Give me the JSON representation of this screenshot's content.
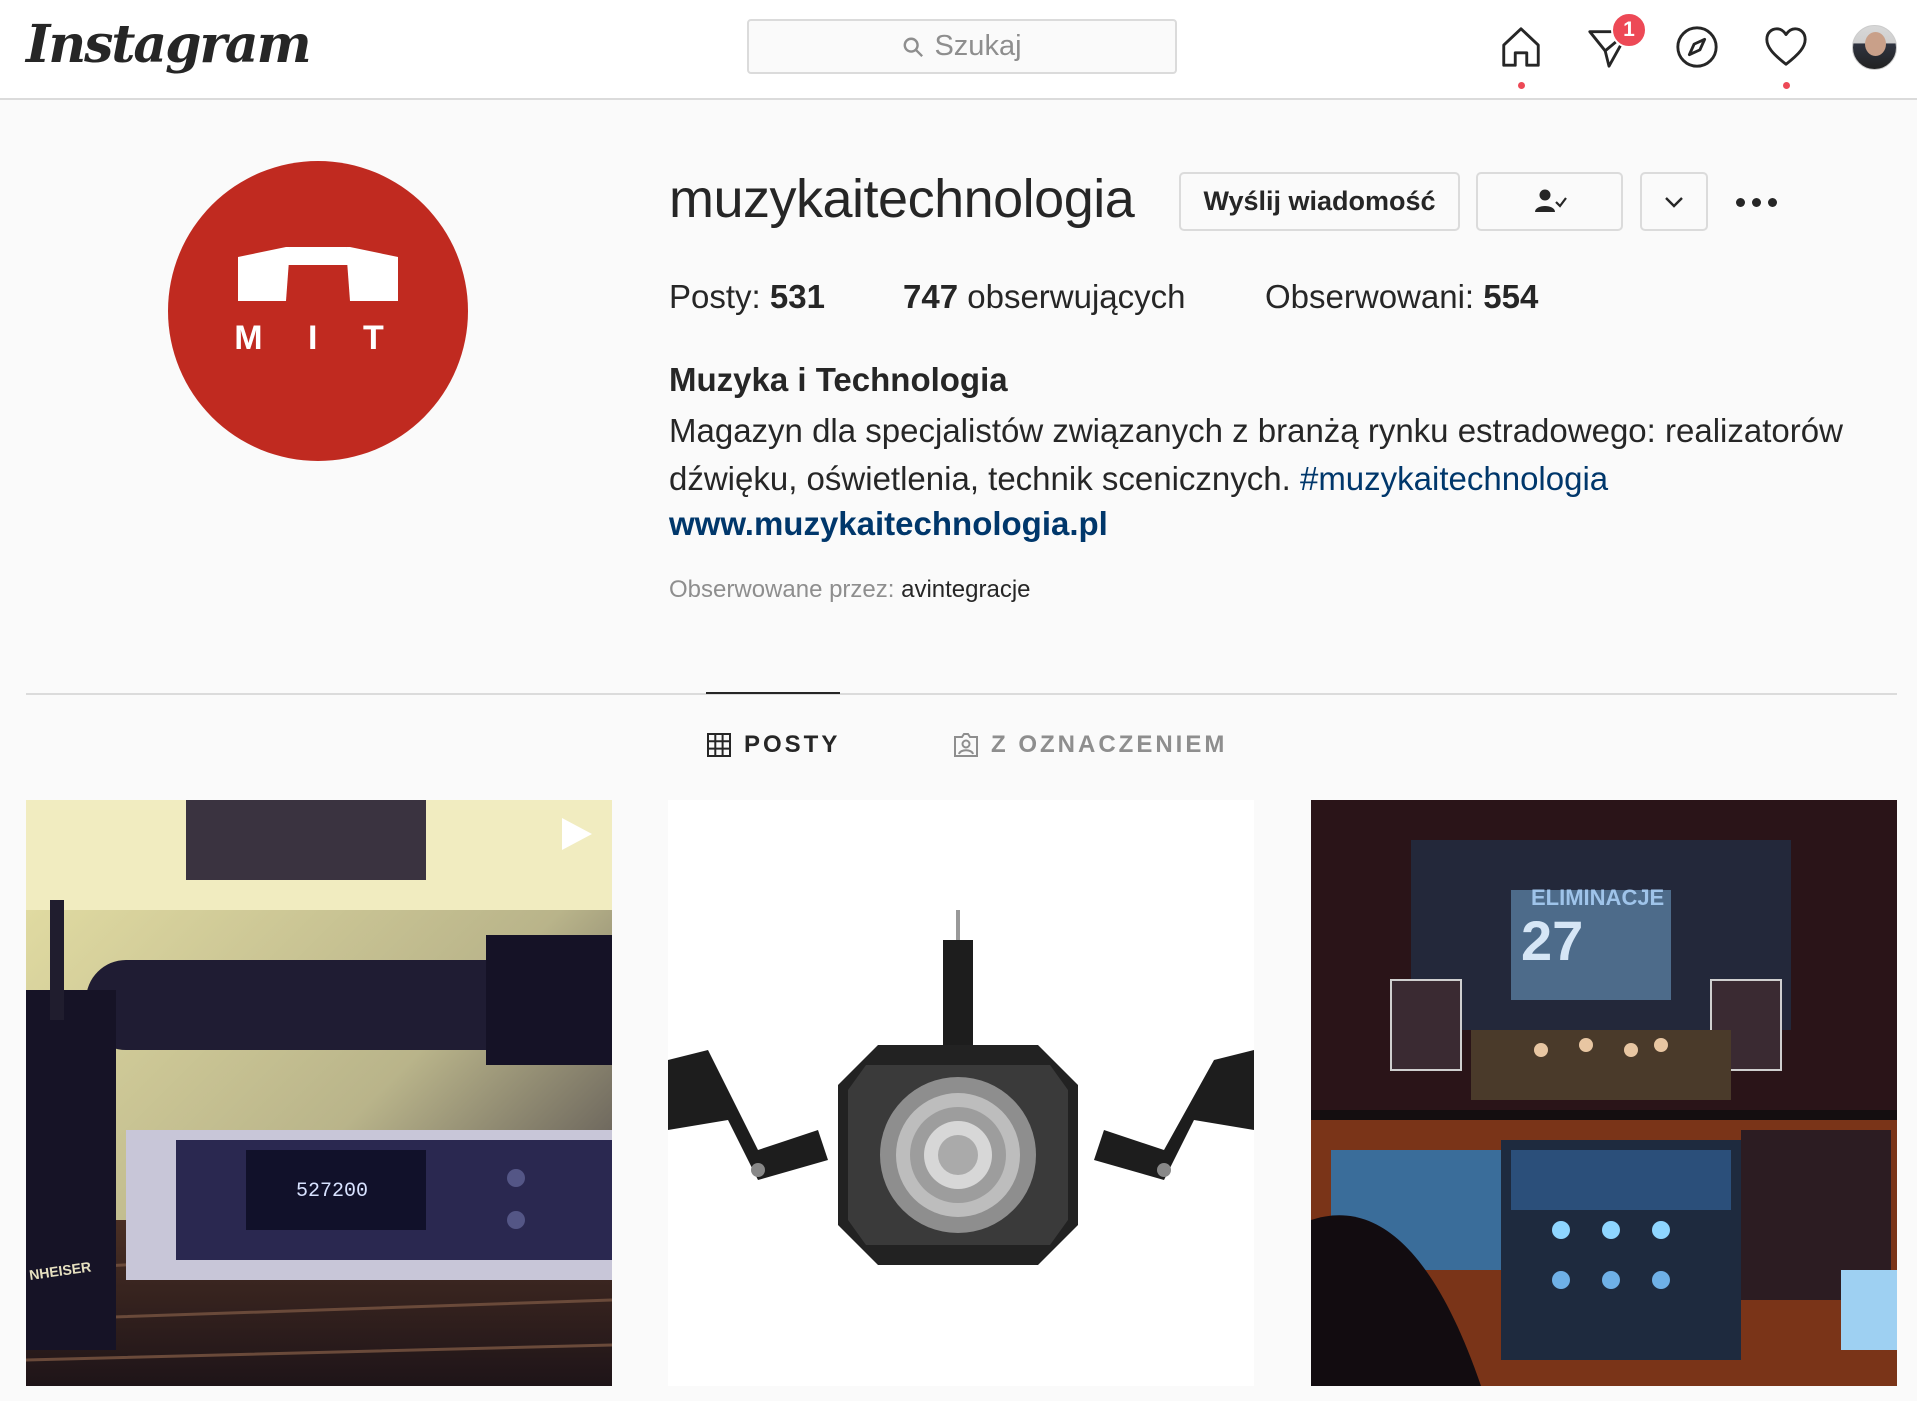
{
  "nav": {
    "logo": "Instagram",
    "search_placeholder": "Szukaj",
    "direct_badge": "1",
    "icons": [
      "home-icon",
      "direct-icon",
      "explore-icon",
      "activity-icon",
      "profile-avatar"
    ]
  },
  "profile": {
    "username": "muzykaitechnologia",
    "avatar_logo_text": "M I T",
    "message_button": "Wyślij wiadomość",
    "stats": {
      "posts_label": "Posty:",
      "posts_value": "531",
      "followers_value": "747",
      "followers_label": "obserwujących",
      "following_label": "Obserwowani:",
      "following_value": "554"
    },
    "full_name": "Muzyka i Technologia",
    "bio_text": "Magazyn dla specjalistów związanych z branżą rynku estradowego: realizatorów dźwięku, oświetlenia, technik scenicznych.",
    "bio_hashtag": "#muzykaitechnologia",
    "website": "www.muzykaitechnologia.pl",
    "followed_by_label": "Obserwowane przez:",
    "followed_by_user": "avintegracje"
  },
  "tabs": [
    {
      "label": "POSTY",
      "icon": "grid-icon",
      "active": true
    },
    {
      "label": "Z OZNACZENIEM",
      "icon": "tagged-icon",
      "active": false
    }
  ],
  "colors": {
    "accent_red": "#ed4956",
    "link_blue": "#00376b",
    "brand_red": "#c02a20"
  }
}
